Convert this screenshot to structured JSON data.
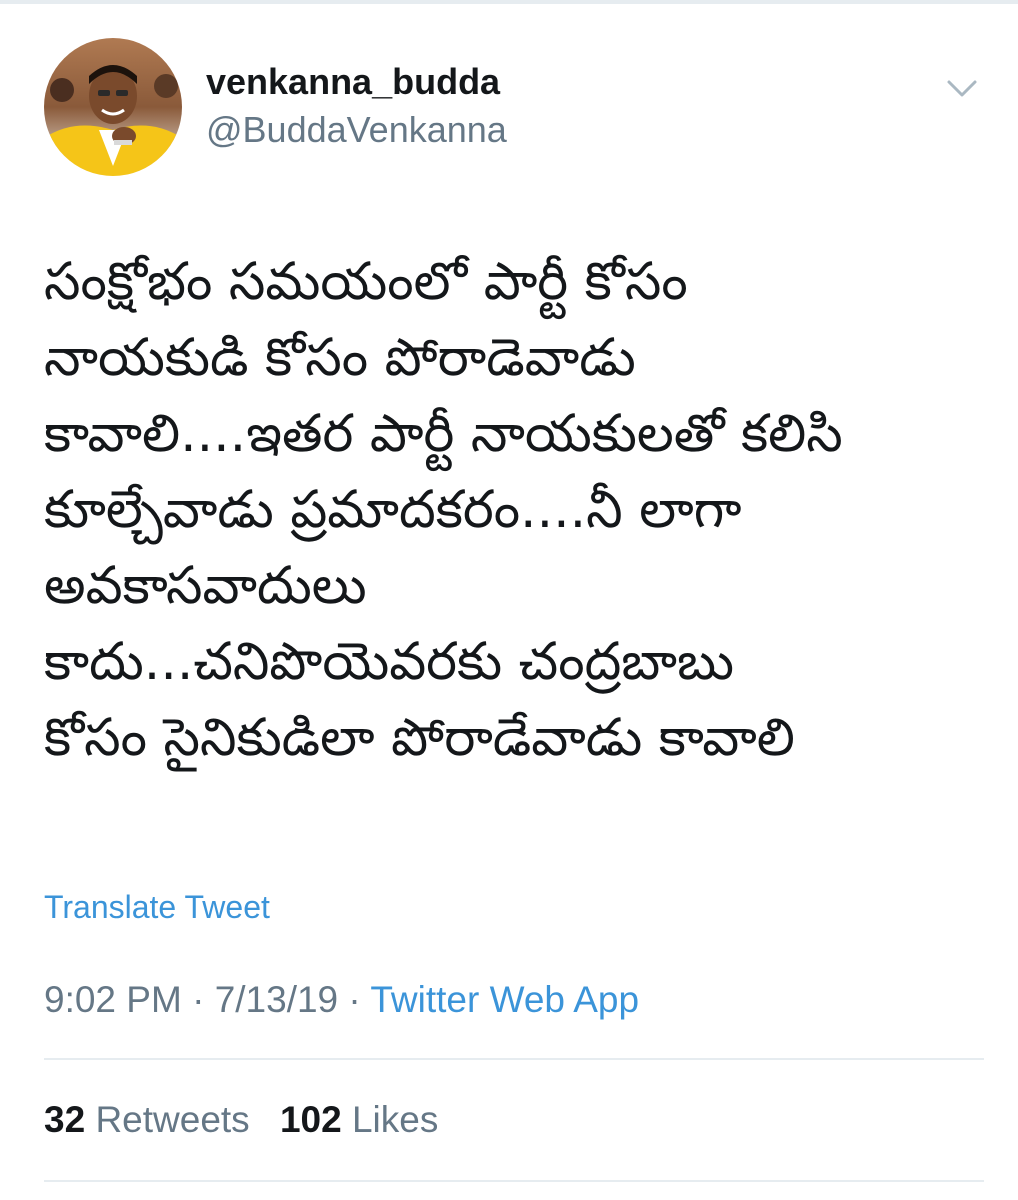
{
  "user": {
    "display_name": "venkanna_budda",
    "handle": "@BuddaVenkanna",
    "avatar_icon": "user-avatar"
  },
  "menu": {
    "icon": "chevron-down-icon",
    "color": "#aab8c2"
  },
  "tweet": {
    "lines": [
      "సంక్షోభం సమయంలో పార్టీ కోసం",
      "నాయకుడి కోసం పోరాడెవాడు",
      "కావాలి....ఇతర పార్టీ నాయకులతో కలిసి",
      "కూల్చేవాడు ప్రమాదకరం....నీ లాగా",
      "అవకాసవాదులు",
      "కాదు...చనిపొయెవరకు చంద్రబాబు",
      "కోసం సైనికుడిలా పోరాడేవాడు కావాలి"
    ],
    "translate_label": "Translate Tweet"
  },
  "meta": {
    "time": "9:02 PM",
    "separator": " · ",
    "date": "7/13/19",
    "source": "Twitter Web App"
  },
  "stats": {
    "retweets_count": "32",
    "retweets_label": "Retweets",
    "likes_count": "102",
    "likes_label": "Likes"
  },
  "colors": {
    "link": "#3b94d9",
    "secondary_text": "#657786",
    "primary_text": "#14171a",
    "divider": "#e6ecf0"
  }
}
